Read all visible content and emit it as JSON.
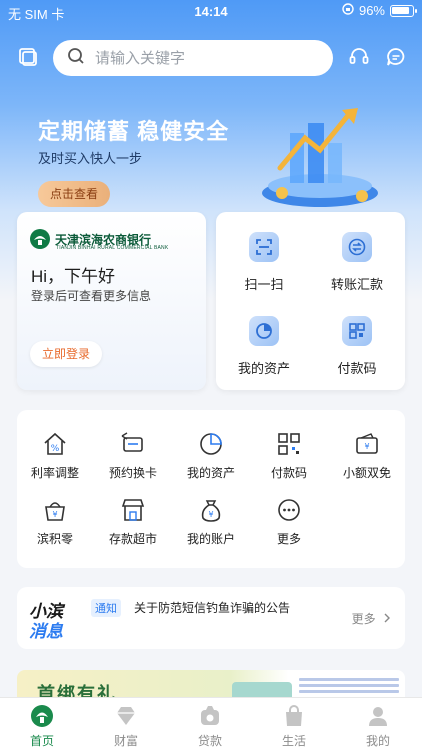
{
  "status_bar": {
    "carrier": "无 SIM 卡",
    "time": "14:14",
    "battery": "96%"
  },
  "header": {
    "search_placeholder": "请输入关键字"
  },
  "banner": {
    "title": "定期储蓄 稳健安全",
    "subtitle": "及时买入快人一步",
    "button": "点击查看"
  },
  "login_card": {
    "bank_name": "天津滨海农商银行",
    "bank_name_en": "TIANJIN BINHAI RURAL COMMERCIAL BANK",
    "greeting": "Hi，下午好",
    "tip": "登录后可查看更多信息",
    "login_button": "立即登录"
  },
  "quick_actions": [
    {
      "label": "扫一扫",
      "icon": "scan-icon"
    },
    {
      "label": "转账汇款",
      "icon": "transfer-icon"
    },
    {
      "label": "我的资产",
      "icon": "asset-pie-icon"
    },
    {
      "label": "付款码",
      "icon": "qr-pay-icon"
    }
  ],
  "grid": [
    {
      "label": "利率调整",
      "icon": "rate-house-icon"
    },
    {
      "label": "预约换卡",
      "icon": "card-swap-icon"
    },
    {
      "label": "我的资产",
      "icon": "pie-chart-icon"
    },
    {
      "label": "付款码",
      "icon": "qr-code-icon"
    },
    {
      "label": "小额双免",
      "icon": "wallet-icon"
    },
    {
      "label": "滨积零",
      "icon": "piggy-basket-icon"
    },
    {
      "label": "存款超市",
      "icon": "store-icon"
    },
    {
      "label": "我的账户",
      "icon": "money-bag-icon"
    },
    {
      "label": "更多",
      "icon": "more-dots-icon"
    }
  ],
  "notice": {
    "logo_line1": "小滨",
    "logo_line2": "消息",
    "tag": "通知",
    "text": "关于防范短信钓鱼诈骗的公告",
    "more": "更多"
  },
  "promo": {
    "title": "首绑有礼"
  },
  "tabbar": [
    {
      "label": "首页",
      "icon": "home-logo-icon",
      "active": true
    },
    {
      "label": "财富",
      "icon": "diamond-icon",
      "active": false
    },
    {
      "label": "贷款",
      "icon": "loan-icon",
      "active": false
    },
    {
      "label": "生活",
      "icon": "shopping-bag-icon",
      "active": false
    },
    {
      "label": "我的",
      "icon": "user-icon",
      "active": false
    }
  ],
  "colors": {
    "primary_blue": "#4f9af6",
    "accent_orange": "#e86a2c",
    "brand_green": "#1a8a4c",
    "link_blue": "#2d7cf0"
  }
}
